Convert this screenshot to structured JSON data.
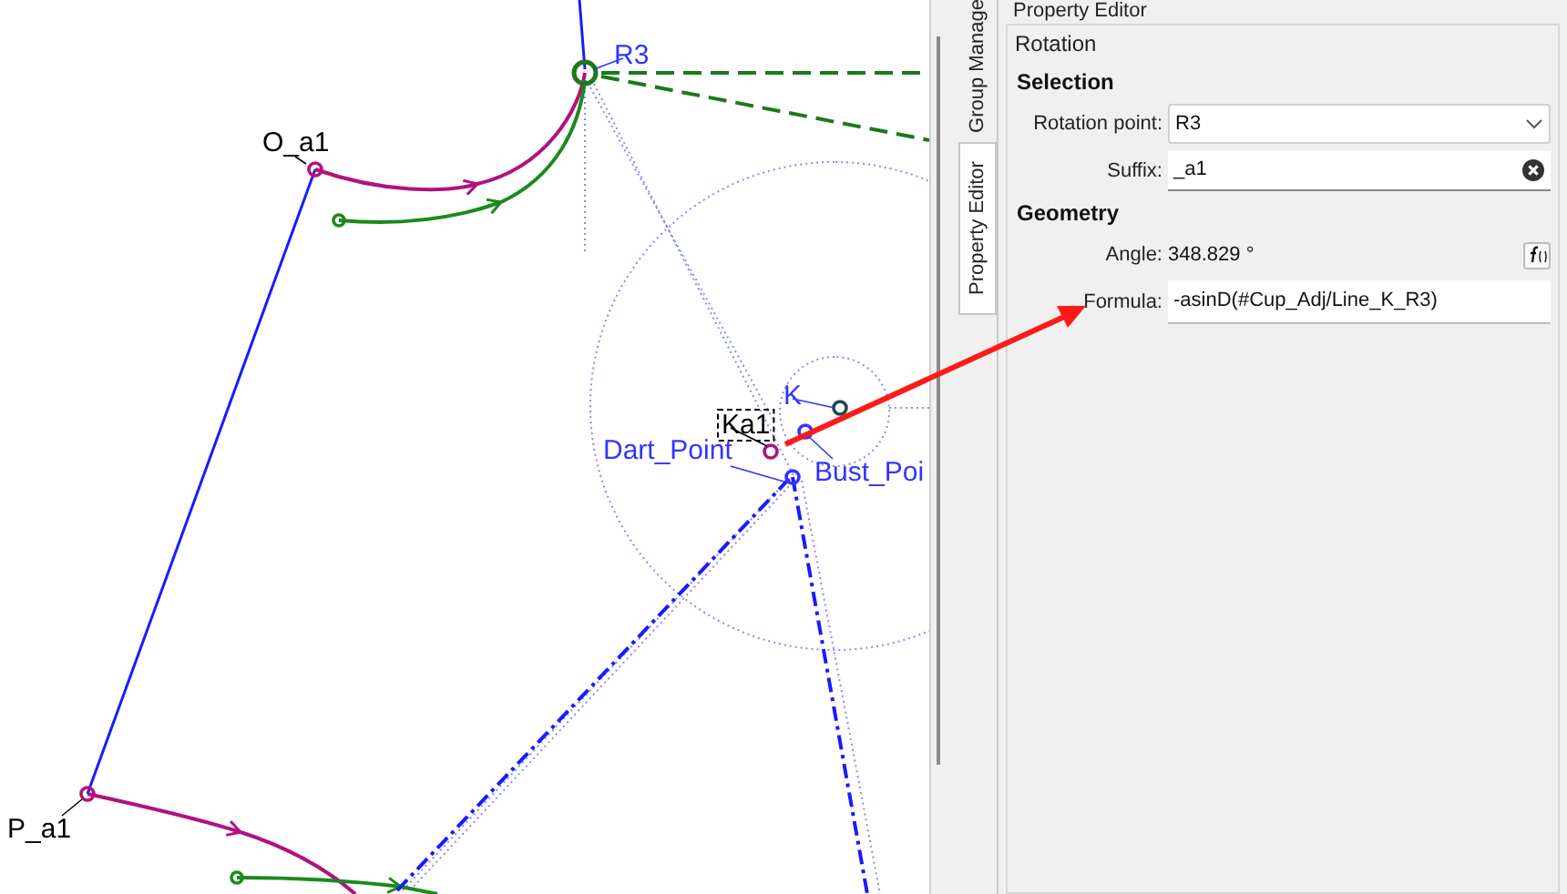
{
  "canvas": {
    "points": [
      {
        "label": "R3",
        "color": "#3333ff",
        "boxed": false
      },
      {
        "label": "O_a1",
        "color": "#000000",
        "boxed": false
      },
      {
        "label": "K",
        "color": "#3333ff",
        "boxed": false
      },
      {
        "label": "Ka1",
        "color": "#000000",
        "boxed": true
      },
      {
        "label": "Dart_Point",
        "color": "#3333ff",
        "boxed": false
      },
      {
        "label": "Bust_Poi",
        "color": "#3333ff",
        "boxed": false
      },
      {
        "label": "P_a1",
        "color": "#000000",
        "boxed": false
      }
    ]
  },
  "dock": {
    "title": "Property Editor",
    "tabs": [
      {
        "label": "Group Manage",
        "selected": false
      },
      {
        "label": "Property Editor",
        "selected": true
      }
    ]
  },
  "panel": {
    "title": "Rotation",
    "sections": [
      {
        "heading": "Selection",
        "fields": [
          {
            "kind": "dropdown",
            "label": "Rotation point:",
            "value": "R3"
          },
          {
            "kind": "clearable",
            "label": "Suffix:",
            "value": "_a1"
          }
        ]
      },
      {
        "heading": "Geometry",
        "fields": [
          {
            "kind": "readout",
            "label": "Angle:",
            "value": "348.829 °"
          },
          {
            "kind": "formula",
            "label": "Formula:",
            "value": "-asinD(#Cup_Adj/Line_K_R3)"
          }
        ]
      }
    ]
  }
}
